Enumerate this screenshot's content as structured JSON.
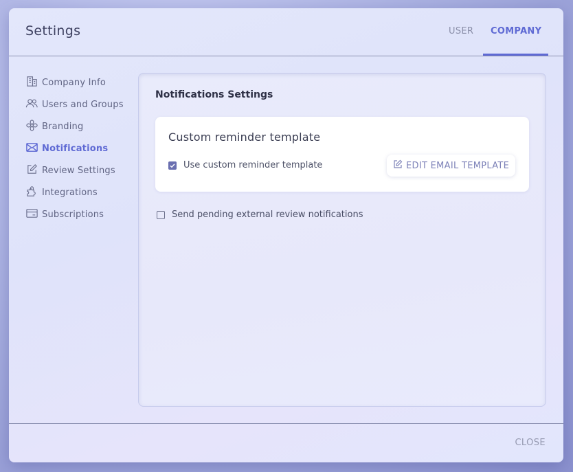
{
  "dialog": {
    "title": "Settings"
  },
  "tabs": [
    {
      "label": "USER",
      "active": false
    },
    {
      "label": "COMPANY",
      "active": true
    }
  ],
  "sidebar": {
    "items": [
      {
        "label": "Company Info",
        "icon": "building-icon",
        "active": false
      },
      {
        "label": "Users and Groups",
        "icon": "users-icon",
        "active": false
      },
      {
        "label": "Branding",
        "icon": "flower-icon",
        "active": false
      },
      {
        "label": "Notifications",
        "icon": "mail-icon",
        "active": true
      },
      {
        "label": "Review Settings",
        "icon": "edit-icon",
        "active": false
      },
      {
        "label": "Integrations",
        "icon": "puzzle-icon",
        "active": false
      },
      {
        "label": "Subscriptions",
        "icon": "card-icon",
        "active": false
      }
    ]
  },
  "main": {
    "section_title": "Notifications Settings",
    "card": {
      "title": "Custom reminder template",
      "checkbox_label": "Use custom reminder template",
      "checkbox_checked": true,
      "button_label": "EDIT EMAIL TEMPLATE"
    },
    "external_checkbox_label": "Send pending external review notifications",
    "external_checkbox_checked": false
  },
  "footer": {
    "close_label": "CLOSE"
  },
  "colors": {
    "accent": "#5f6ad4",
    "text": "#5f6382",
    "checkbox": "#6a6fb0"
  }
}
